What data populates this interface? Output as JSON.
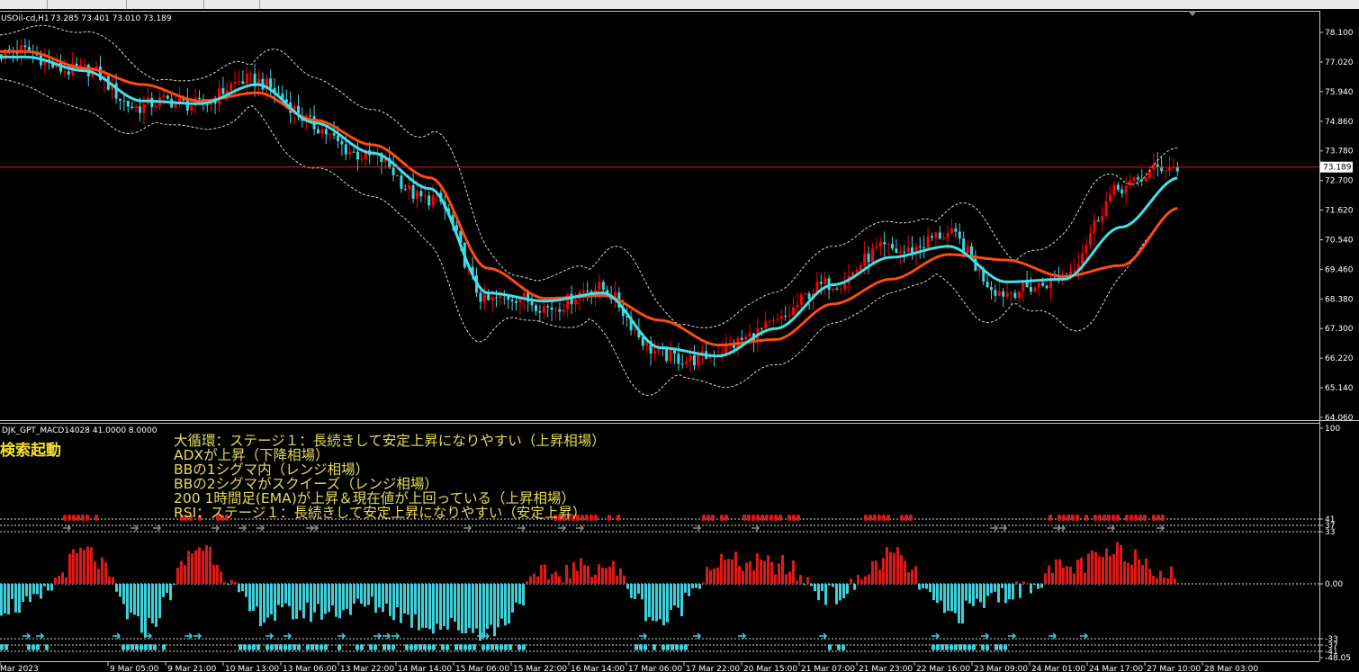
{
  "header": {
    "symbol_label": "USOil-cd,H1",
    "ohlc_label": "73.285 73.401 73.010 73.189"
  },
  "price_axis": {
    "ticks": [
      "78.100",
      "77.020",
      "75.940",
      "74.860",
      "73.780",
      "72.700",
      "71.620",
      "70.540",
      "69.460",
      "68.380",
      "67.300",
      "66.220",
      "65.140",
      "64.060"
    ],
    "current_price_label": "73.189"
  },
  "indicator": {
    "header_label": "DJK_GPT_MACD14028 41.0000 8.0000",
    "search_label": "検索起動",
    "messages": [
      "大循環：ステージ１：長続きして安定上昇になりやすい（上昇相場）",
      "ADXが上昇（下降相場）",
      "BBの1シグマ内（レンジ相場）",
      "BBの2シグマがスクイーズ（レンジ相場）",
      "200 1時間足(EMA)が上昇＆現在値が上回っている（上昇相場）",
      "RSI：ステージ１：長続きして安定上昇になりやすい（安定上昇）"
    ],
    "axis_ticks": [
      "100",
      "41",
      "37",
      "33",
      "0.00",
      "-33",
      "-37",
      "-41",
      "-48.05"
    ]
  },
  "time_axis": {
    "labels": [
      "Mar 2023",
      "9 Mar 05:00",
      "9 Mar 21:00",
      "10 Mar 13:00",
      "13 Mar 06:00",
      "13 Mar 22:00",
      "14 Mar 14:00",
      "15 Mar 06:00",
      "15 Mar 22:00",
      "16 Mar 14:00",
      "17 Mar 06:00",
      "17 Mar 22:00",
      "20 Mar 15:00",
      "21 Mar 07:00",
      "21 Mar 23:00",
      "22 Mar 16:00",
      "23 Mar 09:00",
      "24 Mar 01:00",
      "24 Mar 17:00",
      "27 Mar 10:00",
      "28 Mar 03:00"
    ]
  },
  "colors": {
    "background": "#000000",
    "bull_candle": "#ff0000",
    "bear_candle": "#3fd4df",
    "ema_fast": "#40e0e8",
    "ema_slow": "#ff4a12",
    "bollinger": "#d8d8d8",
    "price_line": "#d42020",
    "histogram_positive": "#e01818",
    "histogram_negative": "#3fcfd8",
    "text_yellow": "#e6dc5a"
  },
  "chart_data": [
    {
      "type": "candlestick",
      "symbol": "USOil-cd",
      "timeframe": "H1",
      "last_ohlc": {
        "open": 73.285,
        "high": 73.401,
        "low": 73.01,
        "close": 73.189
      },
      "ylim": [
        63.6,
        78.6
      ],
      "x_categories": [
        "Mar 2023",
        "9 Mar 05:00",
        "9 Mar 21:00",
        "10 Mar 13:00",
        "13 Mar 06:00",
        "13 Mar 22:00",
        "14 Mar 14:00",
        "15 Mar 06:00",
        "15 Mar 22:00",
        "16 Mar 14:00",
        "17 Mar 06:00",
        "17 Mar 22:00",
        "20 Mar 15:00",
        "21 Mar 07:00",
        "21 Mar 23:00",
        "22 Mar 16:00",
        "23 Mar 09:00",
        "24 Mar 01:00",
        "24 Mar 17:00",
        "27 Mar 10:00",
        "28 Mar 03:00"
      ],
      "close_at_labels": [
        77.3,
        76.6,
        75.4,
        75.6,
        76.4,
        74.6,
        73.4,
        72.0,
        68.4,
        68.2,
        68.7,
        66.2,
        66.4,
        67.6,
        69.1,
        70.2,
        70.6,
        68.5,
        69.3,
        72.6,
        73.2
      ],
      "ema_fast_at_labels": [
        77.2,
        76.7,
        75.6,
        75.5,
        76.2,
        74.8,
        73.7,
        72.4,
        68.6,
        68.3,
        68.6,
        66.6,
        66.3,
        67.3,
        68.9,
        69.9,
        70.3,
        69.0,
        69.1,
        71.0,
        72.8
      ],
      "ema_slow_at_labels": [
        77.4,
        76.8,
        76.2,
        75.6,
        75.9,
        74.9,
        74.0,
        72.8,
        69.5,
        68.4,
        68.5,
        67.6,
        66.7,
        66.9,
        68.2,
        69.1,
        70.0,
        69.8,
        69.2,
        69.6,
        71.7
      ],
      "series": [
        {
          "name": "EMA fast",
          "color": "#40e0e8"
        },
        {
          "name": "EMA slow",
          "color": "#ff4a12"
        },
        {
          "name": "Bollinger Bands",
          "color": "#d8d8d8"
        }
      ]
    },
    {
      "type": "bar",
      "name": "DJK_GPT_MACD14028",
      "params": [
        41.0,
        8.0
      ],
      "levels": [
        41,
        37,
        33,
        0,
        -33,
        -37,
        -41
      ],
      "ylim": [
        -48.05,
        100
      ],
      "x_categories": [
        "Mar 2023",
        "9 Mar 05:00",
        "9 Mar 21:00",
        "10 Mar 13:00",
        "13 Mar 06:00",
        "13 Mar 22:00",
        "14 Mar 14:00",
        "15 Mar 06:00",
        "15 Mar 22:00",
        "16 Mar 14:00",
        "17 Mar 06:00",
        "17 Mar 22:00",
        "20 Mar 15:00",
        "21 Mar 07:00",
        "21 Mar 23:00",
        "22 Mar 16:00",
        "23 Mar 09:00",
        "24 Mar 01:00",
        "24 Mar 17:00",
        "27 Mar 10:00",
        "28 Mar 03:00"
      ],
      "values_at_labels": [
        -14,
        20,
        -28,
        24,
        -20,
        -18,
        -14,
        -26,
        -30,
        6,
        12,
        -24,
        14,
        12,
        -8,
        18,
        -20,
        -6,
        10,
        20,
        5
      ]
    }
  ]
}
